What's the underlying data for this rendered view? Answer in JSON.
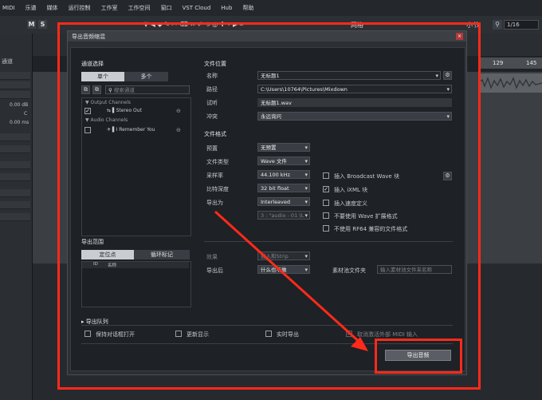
{
  "menubar": {
    "items": [
      "MIDI",
      "乐谱",
      "媒体",
      "运行控制",
      "工作室",
      "工作空间",
      "窗口",
      "VST Cloud",
      "Hub",
      "帮助"
    ]
  },
  "toolbar": {
    "m_label": "M",
    "s_label": "S",
    "grid_label": "网格",
    "zoom_value": "1/16",
    "mode_label": "小节"
  },
  "inspector": {
    "title": "通道",
    "val1": "0.00 dB",
    "val2": "C",
    "val3": "0.00 ms"
  },
  "ruler": {
    "mark1": "129",
    "mark2": "145"
  },
  "dialog": {
    "title": "导出音频缩混",
    "channel_select": {
      "heading": "通道选择",
      "tab_single": "单个",
      "tab_multi": "多个",
      "search_placeholder": "搜索通道",
      "group_output": "Output Channels",
      "item_stereo_out": "Stereo Out",
      "group_audio": "Audio Channels",
      "item_remember": "I Remember You"
    },
    "range": {
      "heading": "导出范围",
      "tab_locator": "定位点",
      "tab_cycle": "循环标记",
      "col_id": "ID",
      "col_name": "名称"
    },
    "file_location": {
      "heading": "文件位置",
      "name_label": "名称",
      "name_value": "无标题1",
      "path_label": "路径",
      "path_value": "C:\\Users\\10764\\Pictures\\Mixdown",
      "preview_label": "试听",
      "preview_value": "无标题1.wav",
      "conflict_label": "冲突",
      "conflict_value": "永远询问"
    },
    "file_format": {
      "heading": "文件格式",
      "preset_label": "预置",
      "preset_value": "无预置",
      "type_label": "文件类型",
      "type_value": "Wave 文件",
      "rate_label": "采样率",
      "rate_value": "44.100 kHz",
      "depth_label": "比特深度",
      "depth_value": "32 bit float",
      "export_as_label": "导出为",
      "export_as_value": "Interleaved",
      "channel_value": "3 : \"audio - 01 (L",
      "opt_broadcast": "插入 Broadcast Wave 块",
      "opt_ixml": "插入 iXML 块",
      "opt_tempo": "插入速度定义",
      "opt_no_wave_ext": "不要使用 Wave 扩展格式",
      "opt_no_rf64": "不使用 RF64 兼容的文件格式",
      "ixml_checked": "✓"
    },
    "effects_label": "效果",
    "effects_value": "插入和Strip",
    "after_export_label": "导出后",
    "after_export_value": "什么也不做",
    "pool_folder_label": "素材池文件夹",
    "pool_folder_placeholder": "输入素材池文件夹名称",
    "queue": {
      "heading": "导出队列",
      "keep_open": "保持对话框打开",
      "update_display": "更新显示",
      "realtime": "实时导出",
      "disable_midi": "取消激活外部 MIDI 输入",
      "disable_midi_check": "✓"
    },
    "export_button": "导出音频"
  },
  "colors": {
    "highlight": "#ff2a1a",
    "dialog_bg": "#2c2f33"
  }
}
